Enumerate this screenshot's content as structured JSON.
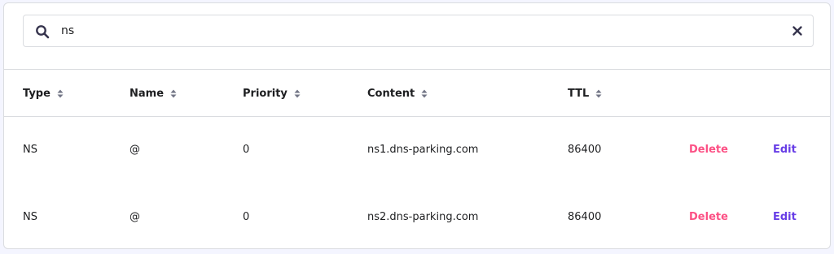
{
  "search": {
    "value": "ns",
    "icon": "search-icon",
    "clear_icon": "close-icon"
  },
  "table": {
    "columns": [
      {
        "label": "Type",
        "sortable": true
      },
      {
        "label": "Name",
        "sortable": true
      },
      {
        "label": "Priority",
        "sortable": true
      },
      {
        "label": "Content",
        "sortable": true
      },
      {
        "label": "TTL",
        "sortable": true
      }
    ],
    "rows": [
      {
        "type": "NS",
        "name": "@",
        "priority": "0",
        "content": "ns1.dns-parking.com",
        "ttl": "86400",
        "delete_label": "Delete",
        "edit_label": "Edit"
      },
      {
        "type": "NS",
        "name": "@",
        "priority": "0",
        "content": "ns2.dns-parking.com",
        "ttl": "86400",
        "delete_label": "Delete",
        "edit_label": "Edit"
      }
    ]
  },
  "colors": {
    "delete": "#fc5185",
    "edit": "#673de6",
    "border": "#dadce0"
  }
}
